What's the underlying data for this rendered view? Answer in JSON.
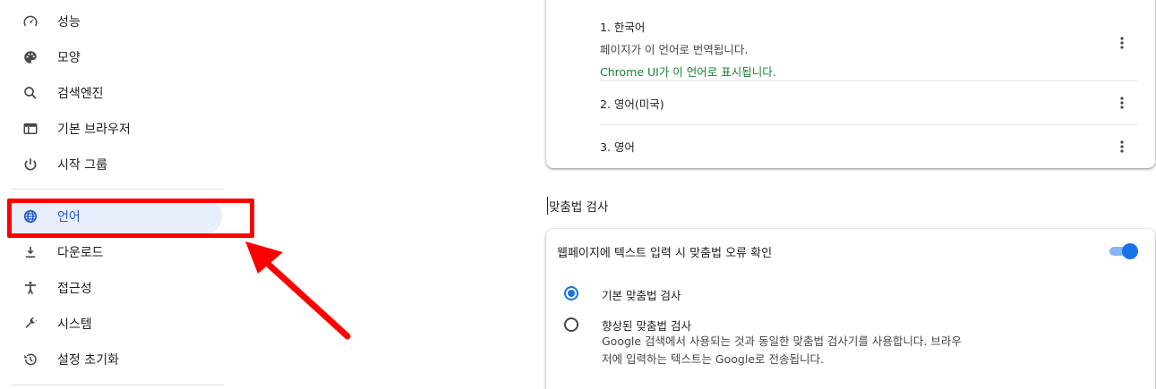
{
  "sidebar": {
    "items": [
      {
        "id": "performance",
        "label": "성능",
        "icon": "speedometer-icon"
      },
      {
        "id": "appearance",
        "label": "모양",
        "icon": "palette-icon"
      },
      {
        "id": "search-engine",
        "label": "검색엔진",
        "icon": "search-icon"
      },
      {
        "id": "default-browser",
        "label": "기본 브라우저",
        "icon": "browser-window-icon"
      },
      {
        "id": "on-startup",
        "label": "시작 그룹",
        "icon": "power-icon"
      },
      {
        "id": "languages",
        "label": "언어",
        "icon": "globe-icon",
        "selected": true
      },
      {
        "id": "downloads",
        "label": "다운로드",
        "icon": "download-icon"
      },
      {
        "id": "accessibility",
        "label": "접근성",
        "icon": "accessibility-icon"
      },
      {
        "id": "system",
        "label": "시스템",
        "icon": "wrench-icon"
      },
      {
        "id": "reset",
        "label": "설정 초기화",
        "icon": "history-icon"
      }
    ]
  },
  "languages": {
    "list": [
      {
        "name": "1. 한국어",
        "desc": "페이지가 이 언어로 번역됩니다.",
        "ui_note": "Chrome UI가 이 언어로 표시됩니다."
      },
      {
        "name": "2. 영어(미국)"
      },
      {
        "name": "3. 영어"
      }
    ]
  },
  "spellcheck": {
    "section_title": "맞춤법 검사",
    "toggle_label": "웹페이지에 텍스트 입력 시 맞춤법 오류 확인",
    "toggle_on": true,
    "options": [
      {
        "label": "기본 맞춤법 검사",
        "checked": true
      },
      {
        "label": "향상된 맞춤법 검사",
        "checked": false,
        "desc_line1": "Google 검색에서 사용되는 것과 동일한 맞춤법 검사기를 사용합니다. 브라우",
        "desc_line2": "저에 입력하는 텍스트는 Google로 전송됩니다."
      }
    ]
  },
  "colors": {
    "accent": "#1a73e8",
    "annotation": "#ff0000",
    "selected_bg": "#e8eefb",
    "ui_note_green": "#188038"
  }
}
